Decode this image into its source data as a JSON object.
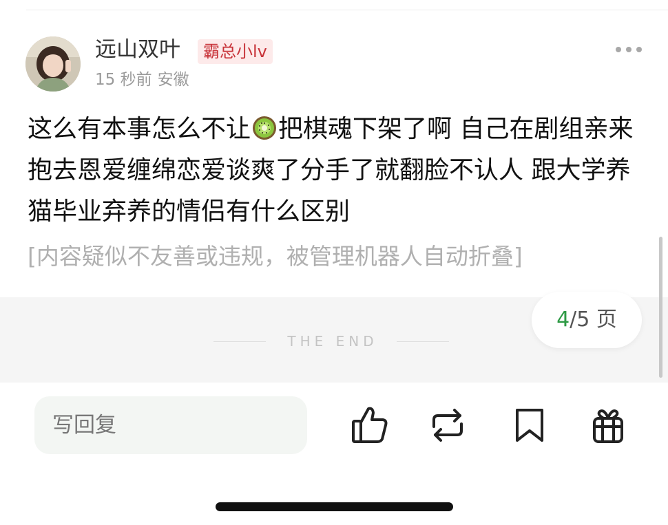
{
  "post": {
    "author": "远山双叶",
    "badge": "霸总小lv",
    "time": "15 秒前",
    "location": "安徽",
    "text_before_emoji": "这么有本事怎么不让",
    "emoji": "kiwi-emoji",
    "text_after_emoji": "把棋魂下架了啊 自己在剧组亲来抱去恩爱缠绵恋爱谈爽了分手了就翻脸不认人 跟大学养猫毕业弃养的情侣有什么区别",
    "folded_notice": "[内容疑似不友善或违规，被管理机器人自动折叠]"
  },
  "end_label": "THE END",
  "pagination": {
    "current": "4",
    "total": "/5 页"
  },
  "reply": {
    "placeholder": "写回复"
  },
  "actions": [
    "like-icon",
    "repost-icon",
    "bookmark-icon",
    "gift-icon"
  ],
  "colors": {
    "badge_bg": "#fdeaea",
    "badge_text": "#c8343a",
    "page_current": "#2e9a45",
    "reply_bg": "#f3f6f3"
  }
}
